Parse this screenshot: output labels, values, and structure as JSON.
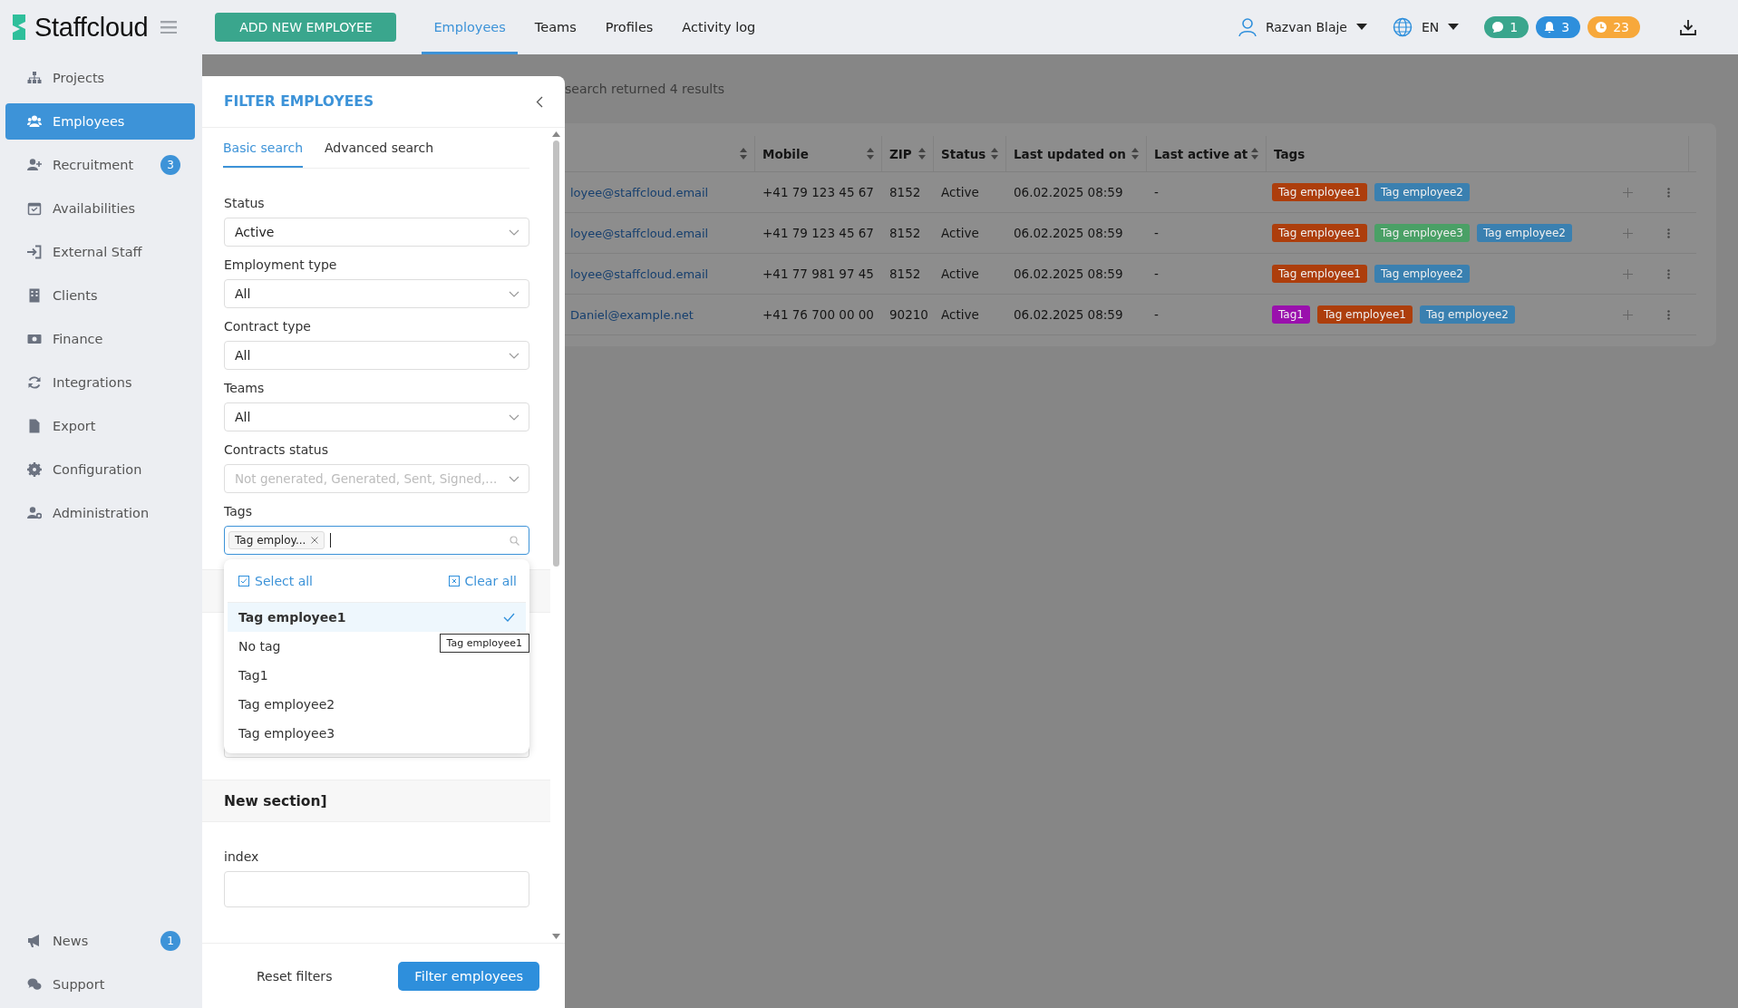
{
  "header": {
    "logo": "Staffcloud",
    "add_button": "ADD NEW EMPLOYEE",
    "tabs": [
      {
        "label": "Employees",
        "selected": true
      },
      {
        "label": "Teams",
        "selected": false
      },
      {
        "label": "Profiles",
        "selected": false
      },
      {
        "label": "Activity log",
        "selected": false
      }
    ],
    "user": "Razvan Blaje",
    "language": "EN",
    "counters": [
      {
        "kind": "chat",
        "count": "1",
        "color": "#3aa68d"
      },
      {
        "kind": "bell",
        "count": "3",
        "color": "#2e8fdc"
      },
      {
        "kind": "clock",
        "count": "23",
        "color": "#f7a83b"
      }
    ]
  },
  "sidebar": {
    "items": [
      {
        "label": "Projects",
        "selected": false
      },
      {
        "label": "Employees",
        "selected": true
      },
      {
        "label": "Recruitment",
        "selected": false,
        "badge": "3"
      },
      {
        "label": "Availabilities",
        "selected": false
      },
      {
        "label": "External Staff",
        "selected": false
      },
      {
        "label": "Clients",
        "selected": false
      },
      {
        "label": "Finance",
        "selected": false
      },
      {
        "label": "Integrations",
        "selected": false
      },
      {
        "label": "Export",
        "selected": false
      },
      {
        "label": "Configuration",
        "selected": false
      },
      {
        "label": "Administration",
        "selected": false
      }
    ],
    "bottom_items": [
      {
        "label": "News",
        "badge": "1"
      },
      {
        "label": "Support"
      }
    ]
  },
  "results_text": "search returned 4 results",
  "table": {
    "columns": [
      {
        "sortable": true
      },
      {
        "label": "Mobile",
        "sortable": true
      },
      {
        "label": "ZIP",
        "sortable": true
      },
      {
        "label": "Status",
        "sortable": true
      },
      {
        "label": "Last updated on",
        "sortable": true
      },
      {
        "label": "Last active at",
        "sortable": true
      },
      {
        "label": "Tags",
        "sortable": false
      }
    ],
    "rows": [
      {
        "email": "loyee@staffcloud.email",
        "mobile": "+41 79 123 45 67",
        "zip": "8152",
        "status": "Active",
        "updated": "06.02.2025 08:59",
        "last_active": "-",
        "tags": [
          {
            "label": "Tag employee1",
            "color": "#ad3e0c"
          },
          {
            "label": "Tag employee2",
            "color": "#3a80b0"
          }
        ]
      },
      {
        "email": "loyee@staffcloud.email",
        "mobile": "+41 79 123 45 67",
        "zip": "8152",
        "status": "Active",
        "updated": "06.02.2025 08:59",
        "last_active": "-",
        "tags": [
          {
            "label": "Tag employee1",
            "color": "#ad3e0c"
          },
          {
            "label": "Tag employee3",
            "color": "#4aa066"
          },
          {
            "label": "Tag employee2",
            "color": "#3a80b0"
          }
        ]
      },
      {
        "email": "loyee@staffcloud.email",
        "mobile": "+41 77 981 97 45",
        "zip": "8152",
        "status": "Active",
        "updated": "06.02.2025 08:59",
        "last_active": "-",
        "tags": [
          {
            "label": "Tag employee1",
            "color": "#ad3e0c"
          },
          {
            "label": "Tag employee2",
            "color": "#3a80b0"
          }
        ]
      },
      {
        "email": "Daniel@example.net",
        "mobile": "+41 76 700 00 00",
        "zip": "90210",
        "status": "Active",
        "updated": "06.02.2025 08:59",
        "last_active": "-",
        "tags": [
          {
            "label": "Tag1",
            "color": "#9a10ad"
          },
          {
            "label": "Tag employee1",
            "color": "#ad3e0c"
          },
          {
            "label": "Tag employee2",
            "color": "#3a80b0"
          }
        ]
      }
    ]
  },
  "filter": {
    "title": "FILTER EMPLOYEES",
    "tabs": [
      {
        "label": "Basic search",
        "selected": true
      },
      {
        "label": "Advanced search",
        "selected": false
      }
    ],
    "fields": [
      {
        "label": "Status",
        "value": "Active"
      },
      {
        "label": "Employment type",
        "value": "All"
      },
      {
        "label": "Contract type",
        "value": "All"
      },
      {
        "label": "Teams",
        "value": "All"
      },
      {
        "label": "Contracts status",
        "placeholder": "Not generated, Generated, Sent, Signed,..."
      }
    ],
    "tags": {
      "label": "Tags",
      "chips": [
        "Tag employ..."
      ]
    },
    "dropdown": {
      "select_all": "Select all",
      "clear_all": "Clear all",
      "tooltip": "Tag employee1",
      "options": [
        {
          "label": "Tag employee1",
          "selected": true
        },
        {
          "label": "No tag",
          "selected": false
        },
        {
          "label": "Tag1",
          "selected": false
        },
        {
          "label": "Tag employee2",
          "selected": false
        },
        {
          "label": "Tag employee3",
          "selected": false
        }
      ]
    },
    "section": "New section]",
    "index_label": "index",
    "reset_button": "Reset filters",
    "apply_button": "Filter employees"
  }
}
